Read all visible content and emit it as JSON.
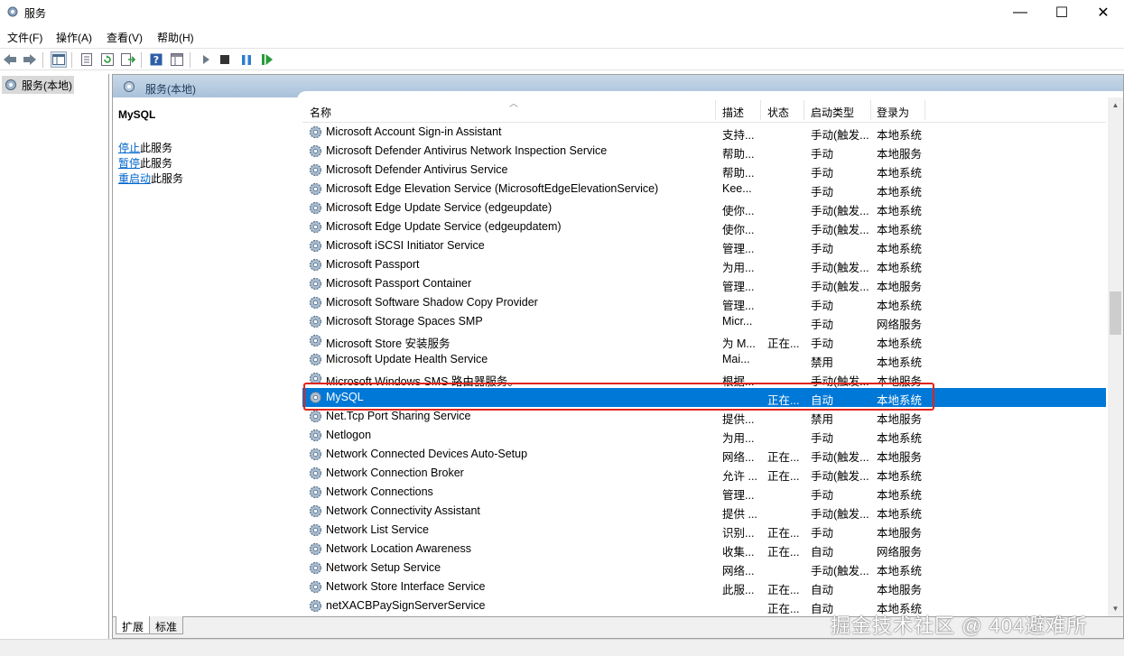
{
  "window": {
    "title": "服务",
    "minimize": "—",
    "maximize": "☐",
    "close": "✕"
  },
  "menu": [
    "文件(F)",
    "操作(A)",
    "查看(V)",
    "帮助(H)"
  ],
  "tree": {
    "root_label": "服务(本地)"
  },
  "pane": {
    "header": "服务(本地)"
  },
  "left_panel": {
    "title": "MySQL",
    "actions": [
      {
        "link": "停止",
        "rest": "此服务"
      },
      {
        "link": "暂停",
        "rest": "此服务"
      },
      {
        "link": "重启动",
        "rest": "此服务"
      }
    ]
  },
  "columns": {
    "name": "名称",
    "desc": "描述",
    "status": "状态",
    "startup": "启动类型",
    "logon": "登录为"
  },
  "rows": [
    {
      "name": "Microsoft Account Sign-in Assistant",
      "desc": "支持...",
      "status": "",
      "startup": "手动(触发...",
      "logon": "本地系统"
    },
    {
      "name": "Microsoft Defender Antivirus Network Inspection Service",
      "desc": "帮助...",
      "status": "",
      "startup": "手动",
      "logon": "本地服务"
    },
    {
      "name": "Microsoft Defender Antivirus Service",
      "desc": "帮助...",
      "status": "",
      "startup": "手动",
      "logon": "本地系统"
    },
    {
      "name": "Microsoft Edge Elevation Service (MicrosoftEdgeElevationService)",
      "desc": "Kee...",
      "status": "",
      "startup": "手动",
      "logon": "本地系统"
    },
    {
      "name": "Microsoft Edge Update Service (edgeupdate)",
      "desc": "使你...",
      "status": "",
      "startup": "手动(触发...",
      "logon": "本地系统"
    },
    {
      "name": "Microsoft Edge Update Service (edgeupdatem)",
      "desc": "使你...",
      "status": "",
      "startup": "手动(触发...",
      "logon": "本地系统"
    },
    {
      "name": "Microsoft iSCSI Initiator Service",
      "desc": "管理...",
      "status": "",
      "startup": "手动",
      "logon": "本地系统"
    },
    {
      "name": "Microsoft Passport",
      "desc": "为用...",
      "status": "",
      "startup": "手动(触发...",
      "logon": "本地系统"
    },
    {
      "name": "Microsoft Passport Container",
      "desc": "管理...",
      "status": "",
      "startup": "手动(触发...",
      "logon": "本地服务"
    },
    {
      "name": "Microsoft Software Shadow Copy Provider",
      "desc": "管理...",
      "status": "",
      "startup": "手动",
      "logon": "本地系统"
    },
    {
      "name": "Microsoft Storage Spaces SMP",
      "desc": "Micr...",
      "status": "",
      "startup": "手动",
      "logon": "网络服务"
    },
    {
      "name": "Microsoft Store 安装服务",
      "desc": "为 M...",
      "status": "正在...",
      "startup": "手动",
      "logon": "本地系统"
    },
    {
      "name": "Microsoft Update Health Service",
      "desc": "Mai...",
      "status": "",
      "startup": "禁用",
      "logon": "本地系统"
    },
    {
      "name": "Microsoft Windows SMS 路由器服务。",
      "desc": "根据...",
      "status": "",
      "startup": "手动(触发...",
      "logon": "本地服务"
    },
    {
      "name": "MySQL",
      "desc": "",
      "status": "正在...",
      "startup": "自动",
      "logon": "本地系统",
      "selected": true
    },
    {
      "name": "Net.Tcp Port Sharing Service",
      "desc": "提供...",
      "status": "",
      "startup": "禁用",
      "logon": "本地服务"
    },
    {
      "name": "Netlogon",
      "desc": "为用...",
      "status": "",
      "startup": "手动",
      "logon": "本地系统"
    },
    {
      "name": "Network Connected Devices Auto-Setup",
      "desc": "网络...",
      "status": "正在...",
      "startup": "手动(触发...",
      "logon": "本地服务"
    },
    {
      "name": "Network Connection Broker",
      "desc": "允许 ...",
      "status": "正在...",
      "startup": "手动(触发...",
      "logon": "本地系统"
    },
    {
      "name": "Network Connections",
      "desc": "管理...",
      "status": "",
      "startup": "手动",
      "logon": "本地系统"
    },
    {
      "name": "Network Connectivity Assistant",
      "desc": "提供 ...",
      "status": "",
      "startup": "手动(触发...",
      "logon": "本地系统"
    },
    {
      "name": "Network List Service",
      "desc": "识别...",
      "status": "正在...",
      "startup": "手动",
      "logon": "本地服务"
    },
    {
      "name": "Network Location Awareness",
      "desc": "收集...",
      "status": "正在...",
      "startup": "自动",
      "logon": "网络服务"
    },
    {
      "name": "Network Setup Service",
      "desc": "网络...",
      "status": "",
      "startup": "手动(触发...",
      "logon": "本地系统"
    },
    {
      "name": "Network Store Interface Service",
      "desc": "此服...",
      "status": "正在...",
      "startup": "自动",
      "logon": "本地服务"
    },
    {
      "name": "netXACBPaySignServerService",
      "desc": "",
      "status": "正在...",
      "startup": "自动",
      "logon": "本地系统"
    }
  ],
  "tabs": [
    "扩展",
    "标准"
  ],
  "watermark": "掘金技术社区 @ 404避难所",
  "colors": {
    "selection": "#0078d7",
    "highlight_box": "#e0251b",
    "link": "#0066cc"
  }
}
